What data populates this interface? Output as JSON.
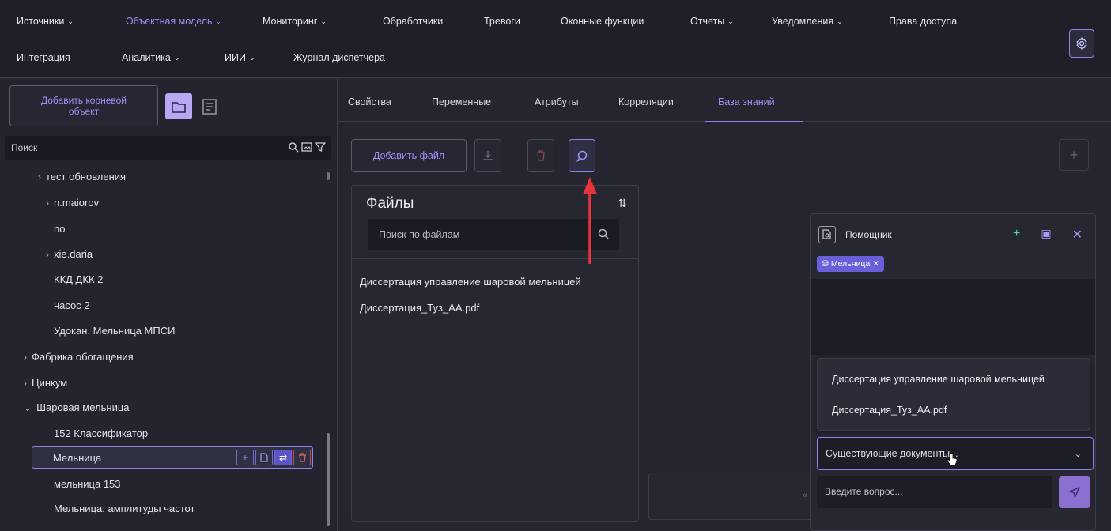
{
  "nav": {
    "row1": [
      {
        "label": "Источники",
        "dropdown": true,
        "active": false
      },
      {
        "label": "Объектная модель",
        "dropdown": true,
        "active": true
      },
      {
        "label": "Мониторинг",
        "dropdown": true,
        "active": false
      },
      {
        "label": "Обработчики",
        "dropdown": false,
        "active": false
      },
      {
        "label": "Тревоги",
        "dropdown": false,
        "active": false
      },
      {
        "label": "Оконные функции",
        "dropdown": false,
        "active": false
      },
      {
        "label": "Отчеты",
        "dropdown": true,
        "active": false
      },
      {
        "label": "Уведомления",
        "dropdown": true,
        "active": false
      },
      {
        "label": "Права доступа",
        "dropdown": false,
        "active": false
      }
    ],
    "row2": [
      {
        "label": "Интеграция",
        "dropdown": false,
        "active": false
      },
      {
        "label": "Аналитика",
        "dropdown": true,
        "active": false
      },
      {
        "label": "ИИИ",
        "dropdown": true,
        "active": false
      },
      {
        "label": "Журнал диспетчера",
        "dropdown": false,
        "active": false
      }
    ],
    "settings_icon": "gear-icon"
  },
  "sidebar": {
    "add_root_label": "Добавить корневой объект",
    "search_placeholder": "Поиск",
    "tree": [
      {
        "label": "тест обновления",
        "arrow": "›",
        "level": 2
      },
      {
        "label": "n.maiorov",
        "arrow": "›",
        "level": 1
      },
      {
        "label": "no",
        "arrow": "",
        "level": 1
      },
      {
        "label": "xie.daria",
        "arrow": "›",
        "level": 1
      },
      {
        "label": "ККД ДКК 2",
        "arrow": "",
        "level": 1
      },
      {
        "label": "насос 2",
        "arrow": "",
        "level": 1
      },
      {
        "label": "Удокан. Мельница МПСИ",
        "arrow": "",
        "level": 1
      },
      {
        "label": "Фабрика обогащения",
        "arrow": "›",
        "level": 0
      },
      {
        "label": "Цинкум",
        "arrow": "›",
        "level": 0
      },
      {
        "label": "Шаровая мельница",
        "arrow": "⌄",
        "level": 0
      },
      {
        "label": "152 Классификатор",
        "arrow": "",
        "level": 1
      },
      {
        "label": "Мельница",
        "arrow": "",
        "level": 1,
        "selected": true
      },
      {
        "label": "мельница 153",
        "arrow": "",
        "level": 1
      },
      {
        "label": "Мельница: амплитуды частот",
        "arrow": "",
        "level": 1
      }
    ]
  },
  "tabs": [
    {
      "label": "Свойства",
      "active": false
    },
    {
      "label": "Переменные",
      "active": false
    },
    {
      "label": "Атрибуты",
      "active": false
    },
    {
      "label": "Корреляции",
      "active": false
    },
    {
      "label": "База знаний",
      "active": true
    }
  ],
  "toolbar": {
    "add_file_label": "Добавить файл"
  },
  "files": {
    "title": "Файлы",
    "search_placeholder": "Поиск по файлам",
    "items": [
      "Диссертация управление шаровой мельницей",
      "Диссертация_Туз_АА.pdf"
    ]
  },
  "assistant": {
    "title": "Помощник",
    "tag": "Мельница",
    "dropdown_items": [
      "Диссертация управление шаровой мельницей",
      "Диссертация_Туз_АА.pdf"
    ],
    "select_value": "Существующие документы...",
    "question_placeholder": "Введите вопрос..."
  },
  "colors": {
    "accent": "#8a84e8",
    "arrow_annotation": "#e8333a"
  }
}
